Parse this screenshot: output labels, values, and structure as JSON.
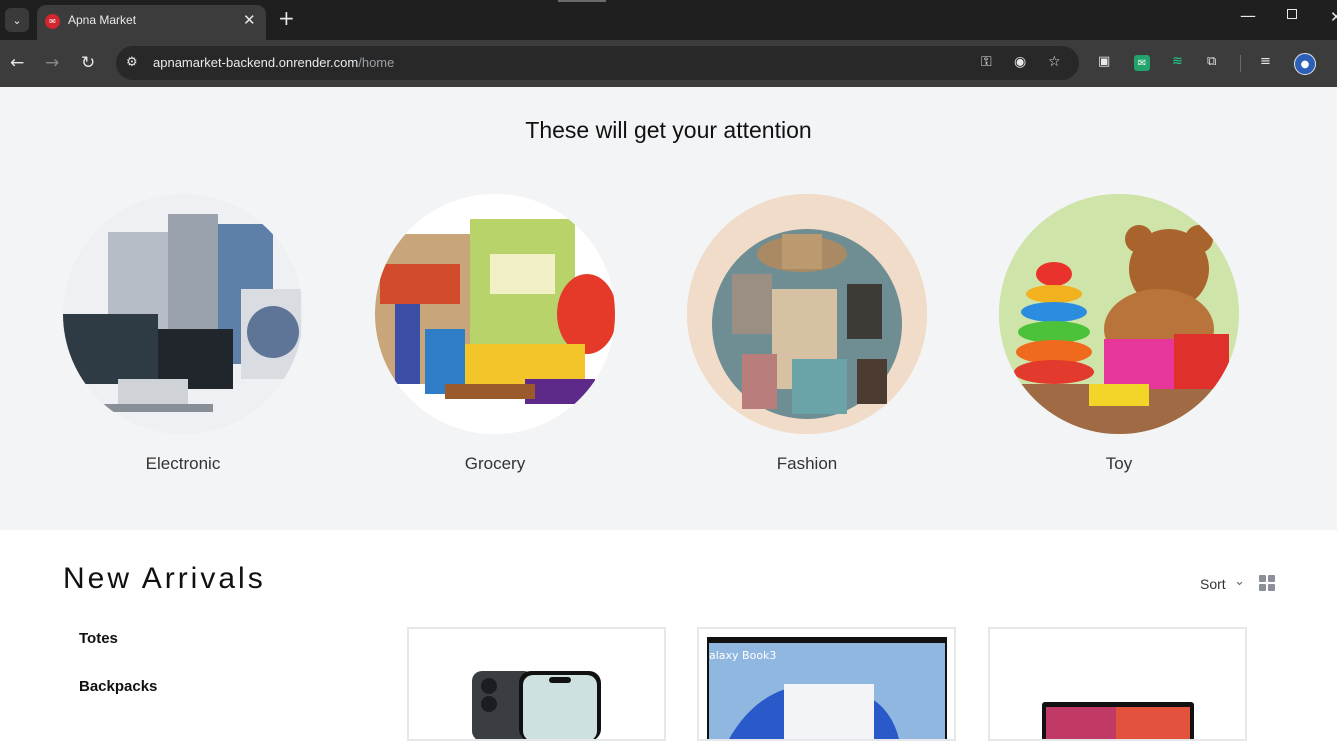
{
  "browser": {
    "tab_title": "Apna Market",
    "url_domain": "apnamarket-backend.onrender.com",
    "url_path": "/home"
  },
  "featured": {
    "heading": "These will get your attention",
    "categories": [
      {
        "label": "Electronic"
      },
      {
        "label": "Grocery"
      },
      {
        "label": "Fashion"
      },
      {
        "label": "Toy"
      }
    ]
  },
  "arrivals": {
    "title": "New Arrivals",
    "sort_label": "Sort",
    "side_items": [
      "Totes",
      "Backpacks"
    ],
    "product_cards": [
      {
        "image": "smartphone"
      },
      {
        "image": "laptop",
        "image_text": "alaxy Book3"
      },
      {
        "image": "tablet"
      }
    ]
  },
  "colors": {
    "accent_red": "#d3262f",
    "featured_bg": "#f3f4f6"
  }
}
